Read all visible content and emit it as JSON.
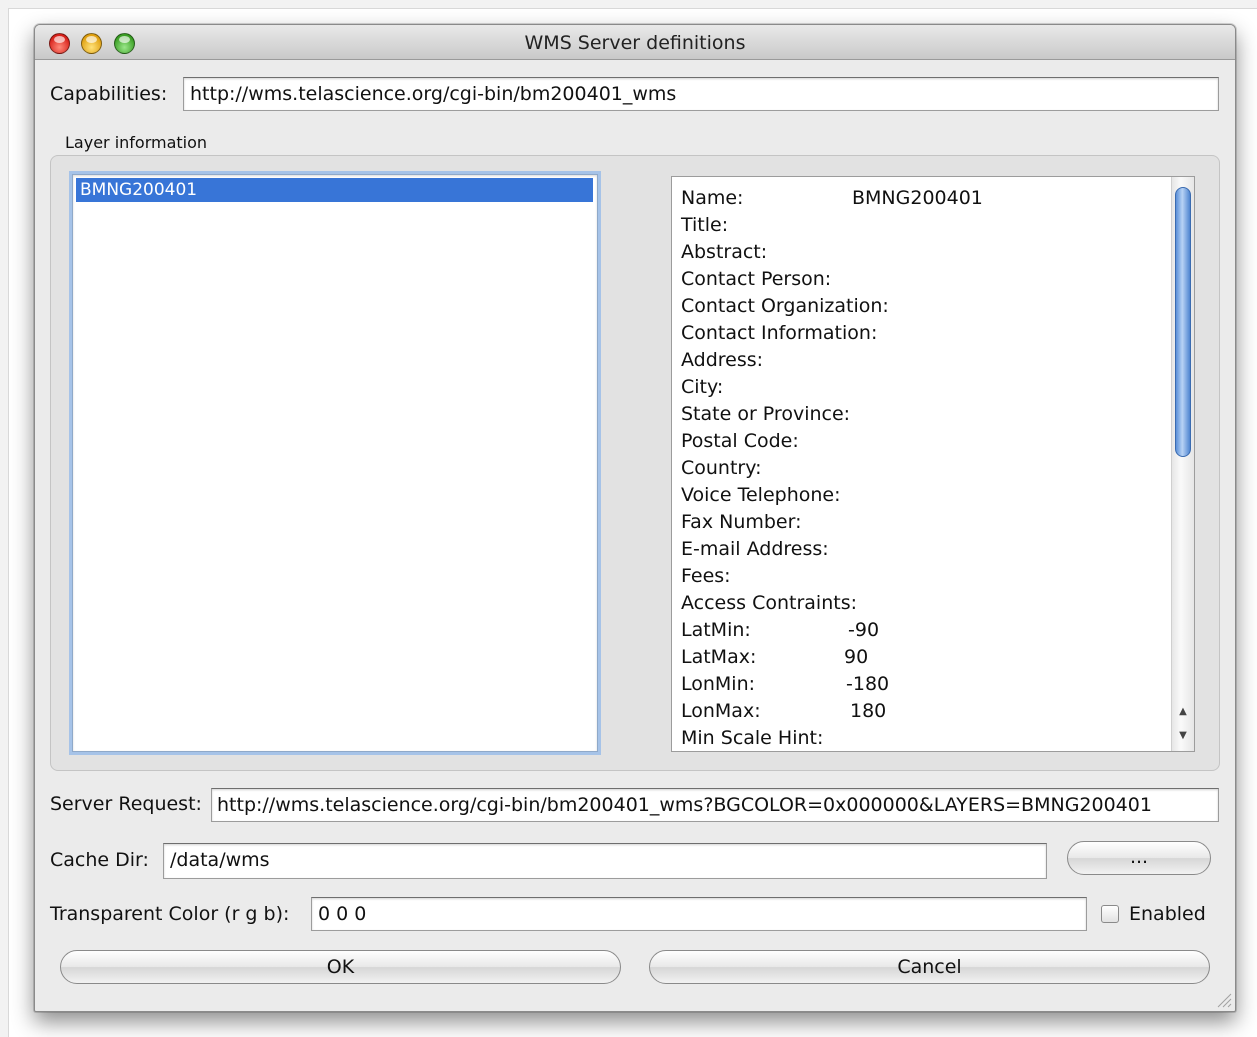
{
  "window": {
    "title": "WMS Server definitions"
  },
  "capabilities": {
    "label": "Capabilities:",
    "value": "http://wms.telascience.org/cgi-bin/bm200401_wms"
  },
  "layer_info": {
    "title": "Layer information",
    "layers": [
      "BMNG200401"
    ],
    "details": [
      {
        "label": "Name:",
        "value": "BMNG200401"
      },
      {
        "label": "Title:",
        "value": ""
      },
      {
        "label": "Abstract:",
        "value": ""
      },
      {
        "label": "Contact Person:",
        "value": ""
      },
      {
        "label": "Contact Organization:",
        "value": ""
      },
      {
        "label": "Contact Information:",
        "value": ""
      },
      {
        "label": "Address:",
        "value": ""
      },
      {
        "label": "City:",
        "value": ""
      },
      {
        "label": "State or Province:",
        "value": ""
      },
      {
        "label": "Postal Code:",
        "value": ""
      },
      {
        "label": "Country:",
        "value": ""
      },
      {
        "label": "Voice Telephone:",
        "value": ""
      },
      {
        "label": "Fax Number:",
        "value": ""
      },
      {
        "label": "E-mail Address:",
        "value": ""
      },
      {
        "label": "Fees:",
        "value": ""
      },
      {
        "label": "Access Contraints:",
        "value": ""
      },
      {
        "label": "LatMin:",
        "value": "-90"
      },
      {
        "label": "LatMax:",
        "value": "90"
      },
      {
        "label": "LonMin:",
        "value": "-180"
      },
      {
        "label": "LonMax:",
        "value": "180"
      },
      {
        "label": "Min Scale Hint:",
        "value": ""
      }
    ]
  },
  "server_request": {
    "label": "Server Request:",
    "value": "http://wms.telascience.org/cgi-bin/bm200401_wms?BGCOLOR=0x000000&LAYERS=BMNG200401"
  },
  "cache_dir": {
    "label": "Cache Dir:",
    "value": "/data/wms",
    "browse_label": "..."
  },
  "transparent": {
    "label": "Transparent Color (r g b):",
    "value": "0 0 0",
    "enabled_label": "Enabled",
    "enabled": false
  },
  "buttons": {
    "ok": "OK",
    "cancel": "Cancel"
  }
}
